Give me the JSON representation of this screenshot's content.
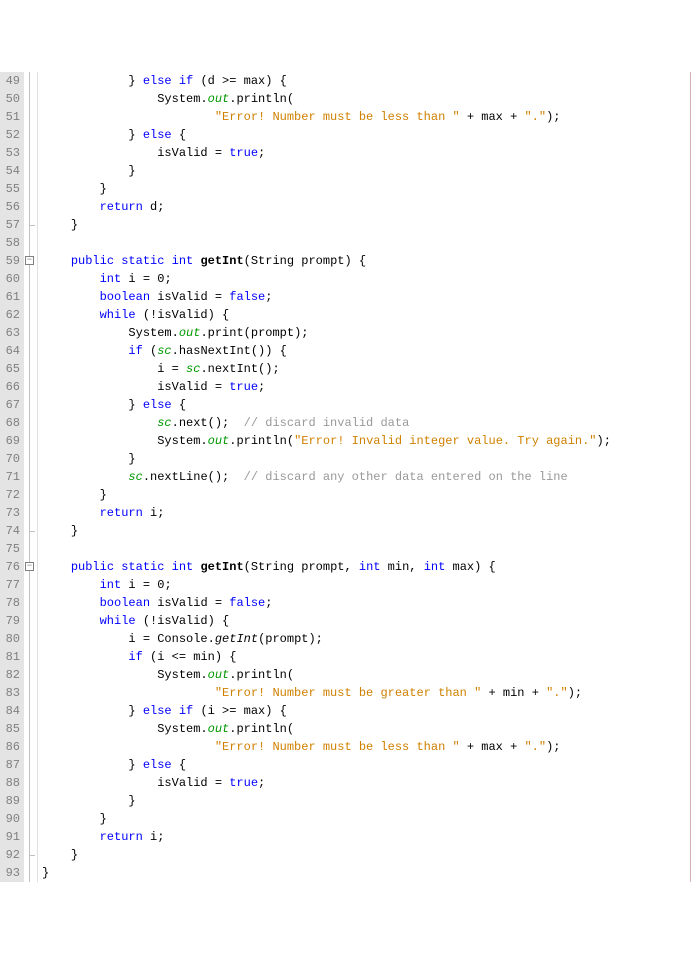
{
  "lineStart": 49,
  "lineEnd": 93,
  "foldMarks": [
    59,
    76
  ],
  "foldCorners": [
    57,
    74,
    92
  ],
  "code": {
    "l49": {
      "indent": 12,
      "tokens": [
        {
          "t": "} ",
          "c": "id"
        },
        {
          "t": "else if",
          "c": "kw"
        },
        {
          "t": " (d >= max) {",
          "c": "id"
        }
      ]
    },
    "l50": {
      "indent": 16,
      "tokens": [
        {
          "t": "System.",
          "c": "id"
        },
        {
          "t": "out",
          "c": "field"
        },
        {
          "t": ".println(",
          "c": "id"
        }
      ]
    },
    "l51": {
      "indent": 24,
      "tokens": [
        {
          "t": "\"Error! Number must be less than \"",
          "c": "str"
        },
        {
          "t": " + max + ",
          "c": "id"
        },
        {
          "t": "\".\"",
          "c": "str"
        },
        {
          "t": ");",
          "c": "id"
        }
      ]
    },
    "l52": {
      "indent": 12,
      "tokens": [
        {
          "t": "} ",
          "c": "id"
        },
        {
          "t": "else",
          "c": "kw"
        },
        {
          "t": " {",
          "c": "id"
        }
      ]
    },
    "l53": {
      "indent": 16,
      "tokens": [
        {
          "t": "isValid = ",
          "c": "id"
        },
        {
          "t": "true",
          "c": "kw"
        },
        {
          "t": ";",
          "c": "id"
        }
      ]
    },
    "l54": {
      "indent": 12,
      "tokens": [
        {
          "t": "}",
          "c": "id"
        }
      ]
    },
    "l55": {
      "indent": 8,
      "tokens": [
        {
          "t": "}",
          "c": "id"
        }
      ]
    },
    "l56": {
      "indent": 8,
      "tokens": [
        {
          "t": "return",
          "c": "kw"
        },
        {
          "t": " d;",
          "c": "id"
        }
      ]
    },
    "l57": {
      "indent": 4,
      "tokens": [
        {
          "t": "}",
          "c": "id"
        }
      ]
    },
    "l58": {
      "indent": 0,
      "tokens": []
    },
    "l59": {
      "indent": 4,
      "tokens": [
        {
          "t": "public static int ",
          "c": "kw"
        },
        {
          "t": "getInt",
          "c": "bold"
        },
        {
          "t": "(String prompt) {",
          "c": "id"
        }
      ]
    },
    "l60": {
      "indent": 8,
      "tokens": [
        {
          "t": "int",
          "c": "kw"
        },
        {
          "t": " i = ",
          "c": "id"
        },
        {
          "t": "0",
          "c": "id"
        },
        {
          "t": ";",
          "c": "id"
        }
      ]
    },
    "l61": {
      "indent": 8,
      "tokens": [
        {
          "t": "boolean",
          "c": "kw"
        },
        {
          "t": " isValid = ",
          "c": "id"
        },
        {
          "t": "false",
          "c": "kw"
        },
        {
          "t": ";",
          "c": "id"
        }
      ]
    },
    "l62": {
      "indent": 8,
      "tokens": [
        {
          "t": "while",
          "c": "kw"
        },
        {
          "t": " (!isValid) {",
          "c": "id"
        }
      ]
    },
    "l63": {
      "indent": 12,
      "tokens": [
        {
          "t": "System.",
          "c": "id"
        },
        {
          "t": "out",
          "c": "field"
        },
        {
          "t": ".print(prompt);",
          "c": "id"
        }
      ]
    },
    "l64": {
      "indent": 12,
      "tokens": [
        {
          "t": "if",
          "c": "kw"
        },
        {
          "t": " (",
          "c": "id"
        },
        {
          "t": "sc",
          "c": "field"
        },
        {
          "t": ".hasNextInt()) {",
          "c": "id"
        }
      ]
    },
    "l65": {
      "indent": 16,
      "tokens": [
        {
          "t": "i = ",
          "c": "id"
        },
        {
          "t": "sc",
          "c": "field"
        },
        {
          "t": ".nextInt();",
          "c": "id"
        }
      ]
    },
    "l66": {
      "indent": 16,
      "tokens": [
        {
          "t": "isValid = ",
          "c": "id"
        },
        {
          "t": "true",
          "c": "kw"
        },
        {
          "t": ";",
          "c": "id"
        }
      ]
    },
    "l67": {
      "indent": 12,
      "tokens": [
        {
          "t": "} ",
          "c": "id"
        },
        {
          "t": "else",
          "c": "kw"
        },
        {
          "t": " {",
          "c": "id"
        }
      ]
    },
    "l68": {
      "indent": 16,
      "tokens": [
        {
          "t": "sc",
          "c": "field"
        },
        {
          "t": ".next();  ",
          "c": "id"
        },
        {
          "t": "// discard invalid data",
          "c": "com"
        }
      ]
    },
    "l69": {
      "indent": 16,
      "tokens": [
        {
          "t": "System.",
          "c": "id"
        },
        {
          "t": "out",
          "c": "field"
        },
        {
          "t": ".println(",
          "c": "id"
        },
        {
          "t": "\"Error! Invalid integer value. Try again.\"",
          "c": "str"
        },
        {
          "t": ");",
          "c": "id"
        }
      ]
    },
    "l70": {
      "indent": 12,
      "tokens": [
        {
          "t": "}",
          "c": "id"
        }
      ]
    },
    "l71": {
      "indent": 12,
      "tokens": [
        {
          "t": "sc",
          "c": "field"
        },
        {
          "t": ".nextLine();  ",
          "c": "id"
        },
        {
          "t": "// discard any other data entered on the line",
          "c": "com"
        }
      ]
    },
    "l72": {
      "indent": 8,
      "tokens": [
        {
          "t": "}",
          "c": "id"
        }
      ]
    },
    "l73": {
      "indent": 8,
      "tokens": [
        {
          "t": "return",
          "c": "kw"
        },
        {
          "t": " i;",
          "c": "id"
        }
      ]
    },
    "l74": {
      "indent": 4,
      "tokens": [
        {
          "t": "}",
          "c": "id"
        }
      ]
    },
    "l75": {
      "indent": 0,
      "tokens": []
    },
    "l76": {
      "indent": 4,
      "tokens": [
        {
          "t": "public static int ",
          "c": "kw"
        },
        {
          "t": "getInt",
          "c": "bold"
        },
        {
          "t": "(String prompt, ",
          "c": "id"
        },
        {
          "t": "int",
          "c": "kw"
        },
        {
          "t": " min, ",
          "c": "id"
        },
        {
          "t": "int",
          "c": "kw"
        },
        {
          "t": " max) {",
          "c": "id"
        }
      ]
    },
    "l77": {
      "indent": 8,
      "tokens": [
        {
          "t": "int",
          "c": "kw"
        },
        {
          "t": " i = ",
          "c": "id"
        },
        {
          "t": "0",
          "c": "id"
        },
        {
          "t": ";",
          "c": "id"
        }
      ]
    },
    "l78": {
      "indent": 8,
      "tokens": [
        {
          "t": "boolean",
          "c": "kw"
        },
        {
          "t": " isValid = ",
          "c": "id"
        },
        {
          "t": "false",
          "c": "kw"
        },
        {
          "t": ";",
          "c": "id"
        }
      ]
    },
    "l79": {
      "indent": 8,
      "tokens": [
        {
          "t": "while",
          "c": "kw"
        },
        {
          "t": " (!isValid) {",
          "c": "id"
        }
      ]
    },
    "l80": {
      "indent": 12,
      "tokens": [
        {
          "t": "i = Console.",
          "c": "id"
        },
        {
          "t": "getInt",
          "c": "method"
        },
        {
          "t": "(prompt);",
          "c": "id"
        }
      ]
    },
    "l81": {
      "indent": 12,
      "tokens": [
        {
          "t": "if",
          "c": "kw"
        },
        {
          "t": " (i <= min) {",
          "c": "id"
        }
      ]
    },
    "l82": {
      "indent": 16,
      "tokens": [
        {
          "t": "System.",
          "c": "id"
        },
        {
          "t": "out",
          "c": "field"
        },
        {
          "t": ".println(",
          "c": "id"
        }
      ]
    },
    "l83": {
      "indent": 24,
      "tokens": [
        {
          "t": "\"Error! Number must be greater than \"",
          "c": "str"
        },
        {
          "t": " + min + ",
          "c": "id"
        },
        {
          "t": "\".\"",
          "c": "str"
        },
        {
          "t": ");",
          "c": "id"
        }
      ]
    },
    "l84": {
      "indent": 12,
      "tokens": [
        {
          "t": "} ",
          "c": "id"
        },
        {
          "t": "else if",
          "c": "kw"
        },
        {
          "t": " (i >= max) {",
          "c": "id"
        }
      ]
    },
    "l85": {
      "indent": 16,
      "tokens": [
        {
          "t": "System.",
          "c": "id"
        },
        {
          "t": "out",
          "c": "field"
        },
        {
          "t": ".println(",
          "c": "id"
        }
      ]
    },
    "l86": {
      "indent": 24,
      "tokens": [
        {
          "t": "\"Error! Number must be less than \"",
          "c": "str"
        },
        {
          "t": " + max + ",
          "c": "id"
        },
        {
          "t": "\".\"",
          "c": "str"
        },
        {
          "t": ");",
          "c": "id"
        }
      ]
    },
    "l87": {
      "indent": 12,
      "tokens": [
        {
          "t": "} ",
          "c": "id"
        },
        {
          "t": "else",
          "c": "kw"
        },
        {
          "t": " {",
          "c": "id"
        }
      ]
    },
    "l88": {
      "indent": 16,
      "tokens": [
        {
          "t": "isValid = ",
          "c": "id"
        },
        {
          "t": "true",
          "c": "kw"
        },
        {
          "t": ";",
          "c": "id"
        }
      ]
    },
    "l89": {
      "indent": 12,
      "tokens": [
        {
          "t": "}",
          "c": "id"
        }
      ]
    },
    "l90": {
      "indent": 8,
      "tokens": [
        {
          "t": "}",
          "c": "id"
        }
      ]
    },
    "l91": {
      "indent": 8,
      "tokens": [
        {
          "t": "return",
          "c": "kw"
        },
        {
          "t": " i;",
          "c": "id"
        }
      ]
    },
    "l92": {
      "indent": 4,
      "tokens": [
        {
          "t": "}",
          "c": "id"
        }
      ]
    },
    "l93": {
      "indent": 0,
      "tokens": [
        {
          "t": "}",
          "c": "id"
        }
      ]
    }
  }
}
